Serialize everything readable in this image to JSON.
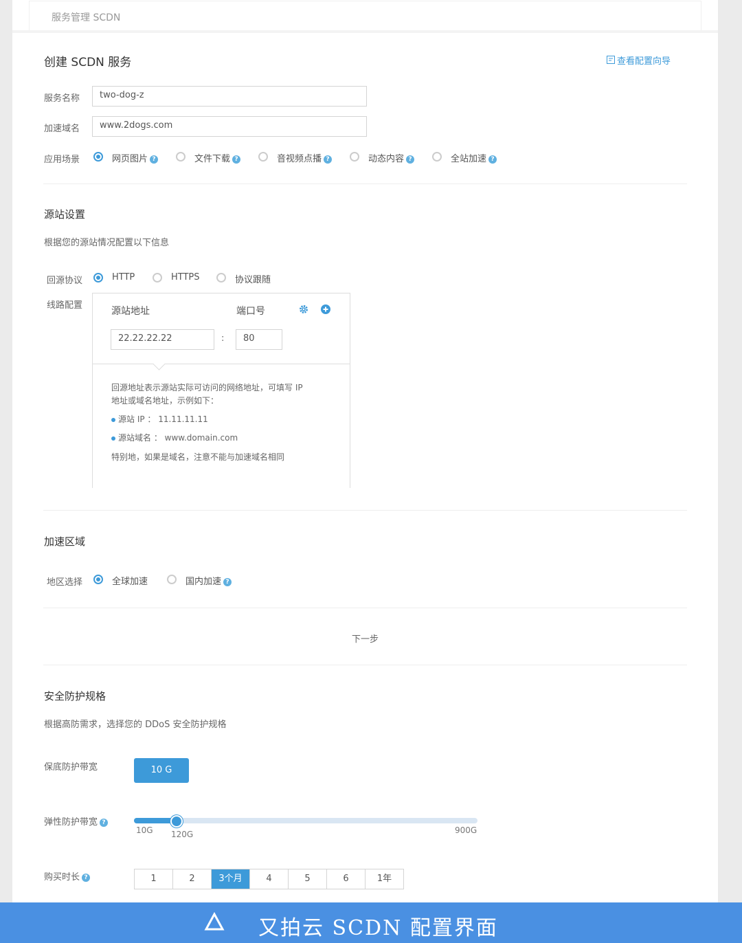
{
  "topbar": {
    "title": "服务管理 SCDN"
  },
  "create": {
    "title": "创建 SCDN 服务",
    "wizard_link": "查看配置向导",
    "name_label": "服务名称",
    "name_value": "two-dog-z",
    "domain_label": "加速域名",
    "domain_value": "www.2dogs.com",
    "scene_label": "应用场景",
    "scenes": [
      {
        "label": "网页图片",
        "selected": true
      },
      {
        "label": "文件下载",
        "selected": false
      },
      {
        "label": "音视频点播",
        "selected": false
      },
      {
        "label": "动态内容",
        "selected": false
      },
      {
        "label": "全站加速",
        "selected": false
      }
    ]
  },
  "origin": {
    "title": "源站设置",
    "desc": "根据您的源站情况配置以下信息",
    "protocol_label": "回源协议",
    "protocols": [
      {
        "label": "HTTP",
        "selected": true
      },
      {
        "label": "HTTPS",
        "selected": false
      },
      {
        "label": "协议跟随",
        "selected": false
      }
    ],
    "route_label": "线路配置",
    "addr_header": "源站地址",
    "port_header": "端口号",
    "addr_value": "22.22.22.22",
    "colon": ":",
    "port_value": "80",
    "help_line1": "回源地址表示源站实际可访问的网络地址，可填写 IP",
    "help_line2": "地址或域名地址，示例如下：",
    "help_ip": "源站 IP ： 11.11.11.11",
    "help_domain": "源站域名 ： www.domain.com",
    "help_note": "特别地，如果是域名，注意不能与加速域名相同"
  },
  "region": {
    "title": "加速区域",
    "label": "地区选择",
    "options": [
      {
        "label": "全球加速",
        "selected": true
      },
      {
        "label": "国内加速",
        "selected": false
      }
    ]
  },
  "next_label": "下一步",
  "security": {
    "title": "安全防护规格",
    "desc": "根据高防需求，选择您的 DDoS 安全防护规格",
    "base_label": "保底防护带宽",
    "base_value": "10 G",
    "elastic_label": "弹性防护带宽",
    "slider": {
      "min": 10,
      "max": 900,
      "value": 120,
      "min_label": "10G",
      "max_label": "900G",
      "value_label": "120G"
    },
    "duration_label": "购买时长",
    "durations": [
      "1",
      "2",
      "3个月",
      "4",
      "5",
      "6",
      "1年"
    ],
    "duration_selected": "3个月"
  },
  "banner": {
    "caption": "又拍云 SCDN 配置界面"
  },
  "colors": {
    "accent": "#3d9ad9",
    "banner": "#4a90e2"
  }
}
